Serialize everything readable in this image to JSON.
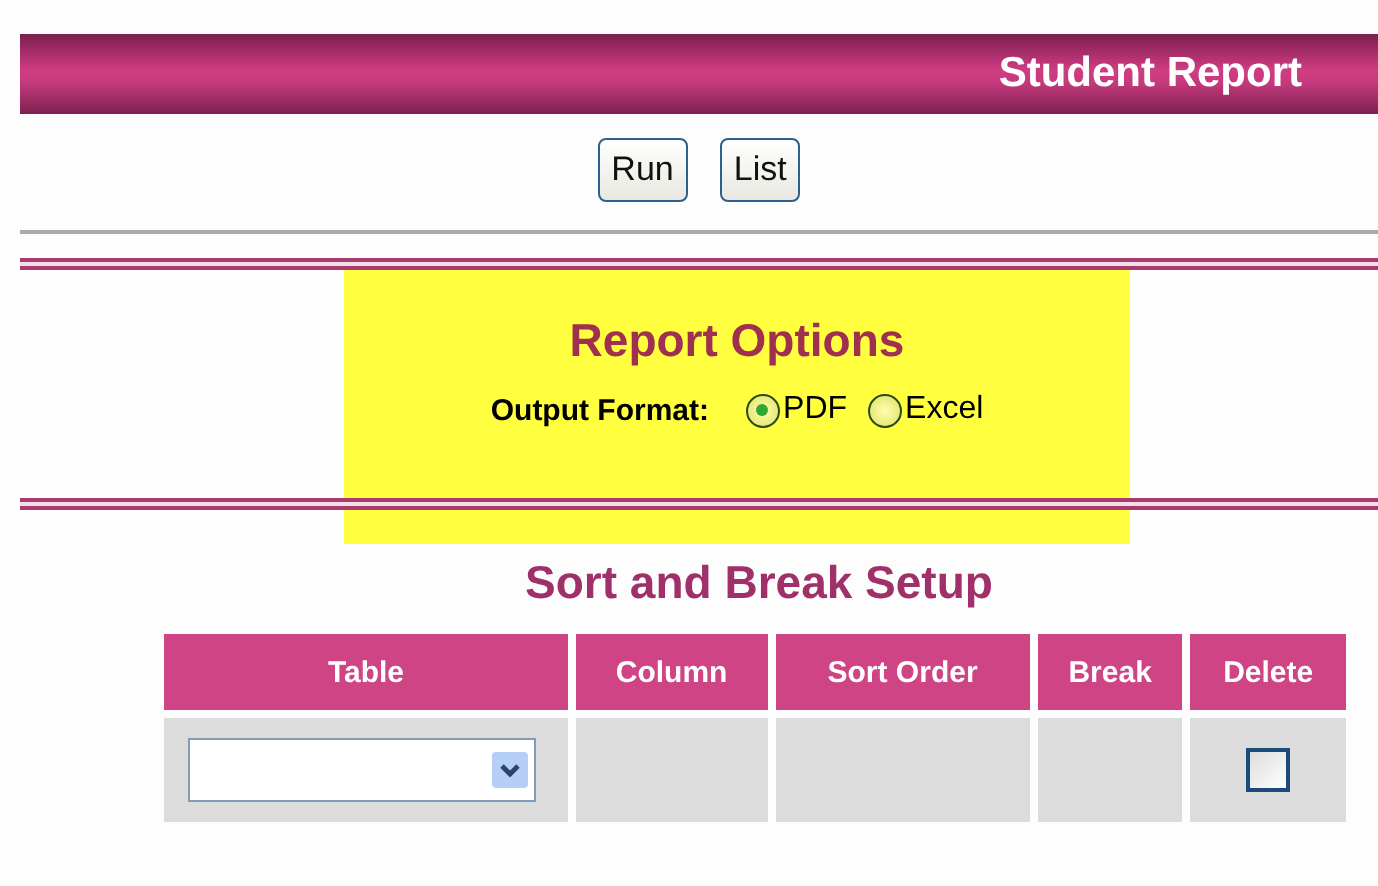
{
  "header": {
    "title": "Student Report"
  },
  "buttons": [
    "Run",
    "List"
  ],
  "report_options": {
    "title": "Report Options",
    "output_format": {
      "label": "Output Format:",
      "options": [
        {
          "label": "PDF",
          "selected": true
        },
        {
          "label": "Excel",
          "selected": false
        }
      ]
    }
  },
  "sort_setup": {
    "title": "Sort and Break Setup",
    "columns": [
      "Table",
      "Column",
      "Sort Order",
      "Break",
      "Delete"
    ],
    "rows": [
      {
        "delete": {
          "checked": false
        }
      }
    ]
  }
}
